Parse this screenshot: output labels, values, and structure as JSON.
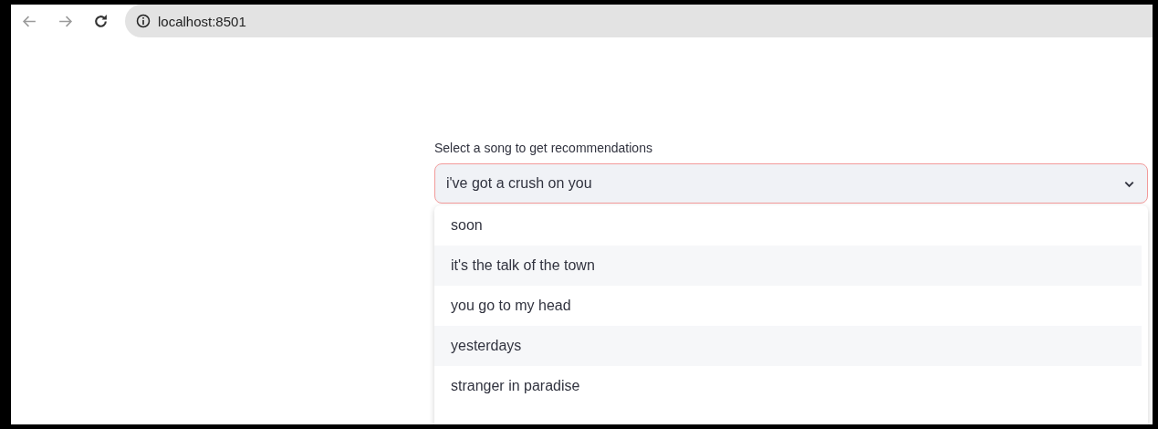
{
  "browser": {
    "url": "localhost:8501"
  },
  "select": {
    "label": "Select a song to get recommendations",
    "value": "i've got a crush on you",
    "expanded": true,
    "options": [
      {
        "label": "soon"
      },
      {
        "label": "it's the talk of the town"
      },
      {
        "label": "you go to my head"
      },
      {
        "label": "yesterdays"
      },
      {
        "label": "stranger in paradise"
      }
    ]
  }
}
